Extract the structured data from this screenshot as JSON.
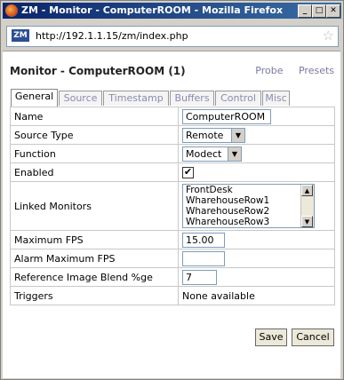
{
  "window": {
    "title": "ZM - Monitor - ComputerROOM - Mozilla Firefox"
  },
  "browser": {
    "url": "http://192.1.1.15/zm/index.php",
    "site_icon_text": "ZM"
  },
  "page": {
    "title": "Monitor - ComputerROOM (1)",
    "links": [
      "Probe",
      "Presets"
    ]
  },
  "tabs": [
    "General",
    "Source",
    "Timestamp",
    "Buffers",
    "Control",
    "Misc"
  ],
  "fields": {
    "name": {
      "label": "Name",
      "value": "ComputerROOM"
    },
    "source_type": {
      "label": "Source Type",
      "value": "Remote"
    },
    "function": {
      "label": "Function",
      "value": "Modect"
    },
    "enabled": {
      "label": "Enabled",
      "checked": "✔"
    },
    "linked_monitors": {
      "label": "Linked Monitors",
      "options": [
        "FrontDesk",
        "WharehouseRow1",
        "WharehouseRow2",
        "WharehouseRow3"
      ]
    },
    "max_fps": {
      "label": "Maximum FPS",
      "value": "15.00"
    },
    "alarm_max_fps": {
      "label": "Alarm Maximum FPS",
      "value": ""
    },
    "ref_blend": {
      "label": "Reference Image Blend %ge",
      "value": "7"
    },
    "triggers": {
      "label": "Triggers",
      "value": "None available"
    }
  },
  "buttons": {
    "save": "Save",
    "cancel": "Cancel"
  }
}
